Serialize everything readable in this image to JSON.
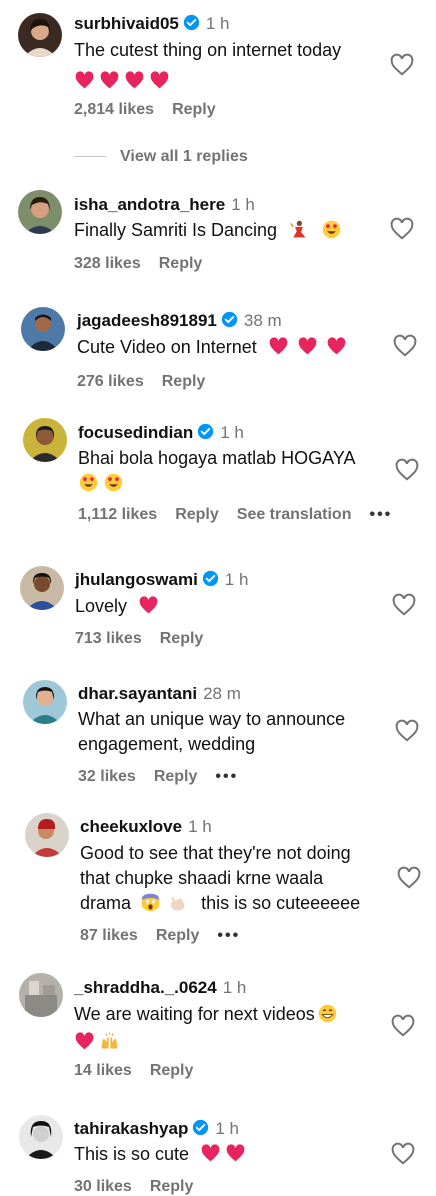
{
  "comments": [
    {
      "username": "surbhivaid05",
      "verified": true,
      "time": "1 h",
      "text": "The cutest thing on internet today",
      "emojis": [
        "heart",
        "heart",
        "heart",
        "heart"
      ],
      "likes": "2,814 likes",
      "reply": "Reply",
      "view_replies": "View all 1 replies"
    },
    {
      "username": "isha_andotra_here",
      "verified": false,
      "time": "1 h",
      "text": "Finally Samriti Is Dancing",
      "emojis": [
        "dancer",
        "heart-eyes"
      ],
      "likes": "328 likes",
      "reply": "Reply"
    },
    {
      "username": "jagadeesh891891",
      "verified": true,
      "time": "38 m",
      "text": "Cute Video on Internet",
      "emojis": [
        "heart",
        "heart",
        "heart"
      ],
      "likes": "276 likes",
      "reply": "Reply"
    },
    {
      "username": "focusedindian",
      "verified": true,
      "time": "1 h",
      "text": "Bhai bola hogaya matlab HOGAYA",
      "emojis": [
        "heart-eyes",
        "heart-eyes"
      ],
      "likes": "1,112 likes",
      "reply": "Reply",
      "see_translation": "See translation",
      "more": "•••"
    },
    {
      "username": "jhulangoswami",
      "verified": true,
      "time": "1 h",
      "text": "Lovely",
      "emojis": [
        "heart"
      ],
      "likes": "713 likes",
      "reply": "Reply"
    },
    {
      "username": "dhar.sayantani",
      "verified": false,
      "time": "28 m",
      "text": "What an unique way to announce engagement, wedding",
      "emojis": [],
      "likes": "32 likes",
      "reply": "Reply",
      "more": "•••"
    },
    {
      "username": "cheekuxlove",
      "verified": false,
      "time": "1 h",
      "text_line1": "Good to see that they're not doing",
      "text_line2": "that chupke shaadi krne waala",
      "text_line3a": "drama",
      "text_line3b": "this is so cuteeeeee",
      "emojis": [
        "screaming",
        "hand"
      ],
      "likes": "87 likes",
      "reply": "Reply",
      "more": "•••"
    },
    {
      "username": "_shraddha._.0624",
      "verified": false,
      "time": "1 h",
      "text": "We are waiting for next videos",
      "emojis": [
        "grin",
        "heart",
        "raised-hands"
      ],
      "likes": "14 likes",
      "reply": "Reply"
    },
    {
      "username": "tahirakashyap",
      "verified": true,
      "time": "1 h",
      "text": "This is so cute",
      "emojis": [
        "heart",
        "heart"
      ],
      "likes": "30 likes",
      "reply": "Reply"
    }
  ],
  "colors": {
    "text": "#111111",
    "secondary": "#737373",
    "verified": "#0095f6",
    "heart_emoji": "#e8245f"
  }
}
